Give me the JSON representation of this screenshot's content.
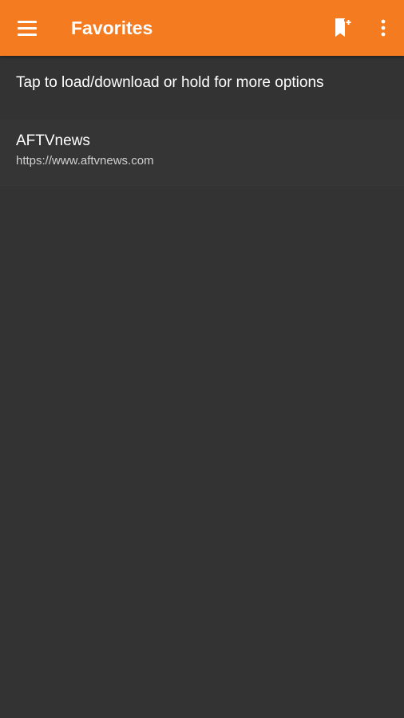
{
  "app_bar": {
    "title": "Favorites",
    "background_color": "#F47B20",
    "menu_icon": "hamburger-menu-icon",
    "bookmark_icon": "bookmark-add-icon",
    "more_icon": "more-vertical-icon"
  },
  "hint": "Tap to load/download or hold for more options",
  "favorites": [
    {
      "name": "AFTVnews",
      "url": "https://www.aftvnews.com"
    }
  ],
  "background_color": "#333333"
}
